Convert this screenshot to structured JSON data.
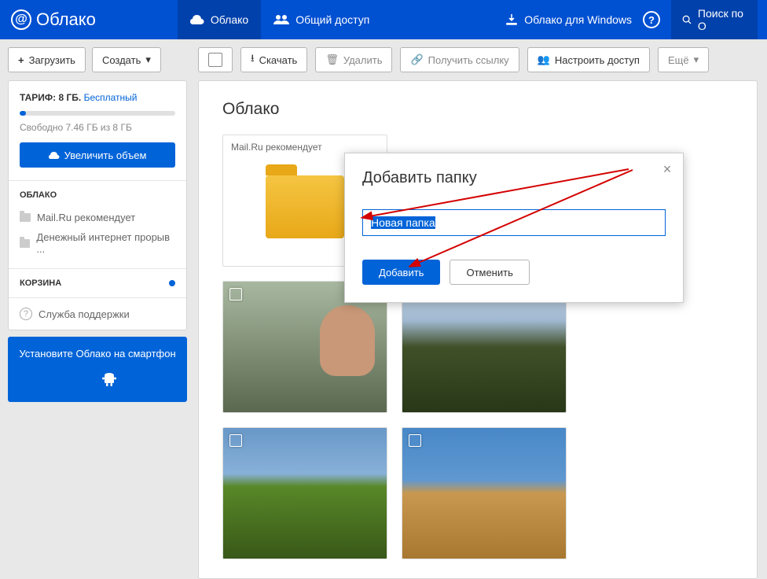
{
  "header": {
    "logo": "Облако",
    "nav": {
      "cloud": "Облако",
      "shared": "Общий доступ"
    },
    "windows_link": "Облако для Windows",
    "search_placeholder": "Поиск по О"
  },
  "sidebar": {
    "upload_btn": "Загрузить",
    "create_btn": "Создать",
    "tariff": {
      "label": "ТАРИФ:",
      "size": "8 ГБ.",
      "plan_link": "Бесплатный",
      "free_text": "Свободно 7.46 ГБ из 8 ГБ",
      "increase_btn": "Увеличить объем"
    },
    "cloud_section": {
      "title": "ОБЛАКО",
      "items": [
        "Mail.Ru рекомендует",
        "Денежный интернет прорыв ..."
      ]
    },
    "trash": {
      "title": "КОРЗИНА"
    },
    "support": "Служба поддержки",
    "promo": {
      "text": "Установите Облако на смартфон"
    }
  },
  "toolbar": {
    "download": "Скачать",
    "delete": "Удалить",
    "get_link": "Получить ссылку",
    "share_settings": "Настроить доступ",
    "more": "Ещё"
  },
  "main": {
    "title": "Облако",
    "recommend_label": "Mail.Ru рекомендует"
  },
  "modal": {
    "title": "Добавить папку",
    "input_value": "Новая папка",
    "submit": "Добавить",
    "cancel": "Отменить",
    "close": "×"
  }
}
